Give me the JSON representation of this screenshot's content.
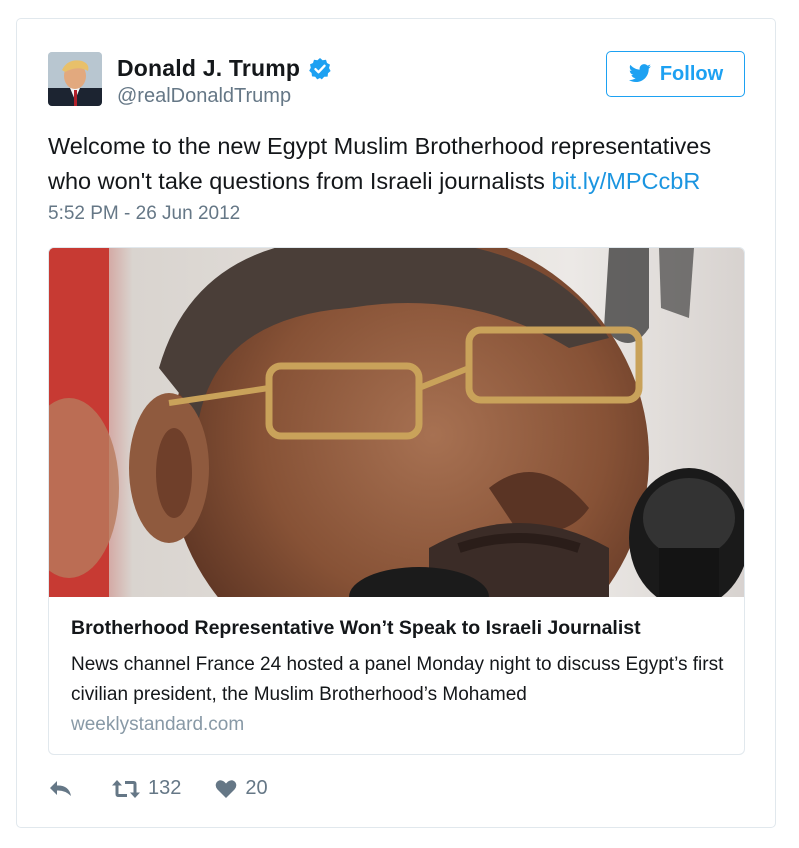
{
  "user": {
    "name": "Donald J. Trump",
    "handle": "@realDonaldTrump",
    "verified": true
  },
  "follow_button": {
    "label": "Follow",
    "icon": "twitter-bird-icon"
  },
  "tweet": {
    "text": "Welcome to the new Egypt Muslim Brotherhood representatives who won't take questions from Israeli journalists ",
    "link": "bit.ly/MPCcbR",
    "timestamp": "5:52 PM - 26 Jun 2012"
  },
  "card": {
    "title": "Brotherhood Representative Won’t Speak to Israeli Journalist",
    "description": "News channel France 24 hosted a panel Monday night to discuss Egypt’s first civilian president, the Muslim Brotherhood’s Mohamed",
    "domain": "weeklystandard.com"
  },
  "actions": {
    "reply_icon": "reply-icon",
    "retweet_icon": "retweet-icon",
    "retweet_count": "132",
    "like_icon": "heart-icon",
    "like_count": "20"
  },
  "colors": {
    "accent": "#1da1f2",
    "link": "#1b95e0",
    "secondary_text": "#657786",
    "border": "#e1e8ed"
  }
}
